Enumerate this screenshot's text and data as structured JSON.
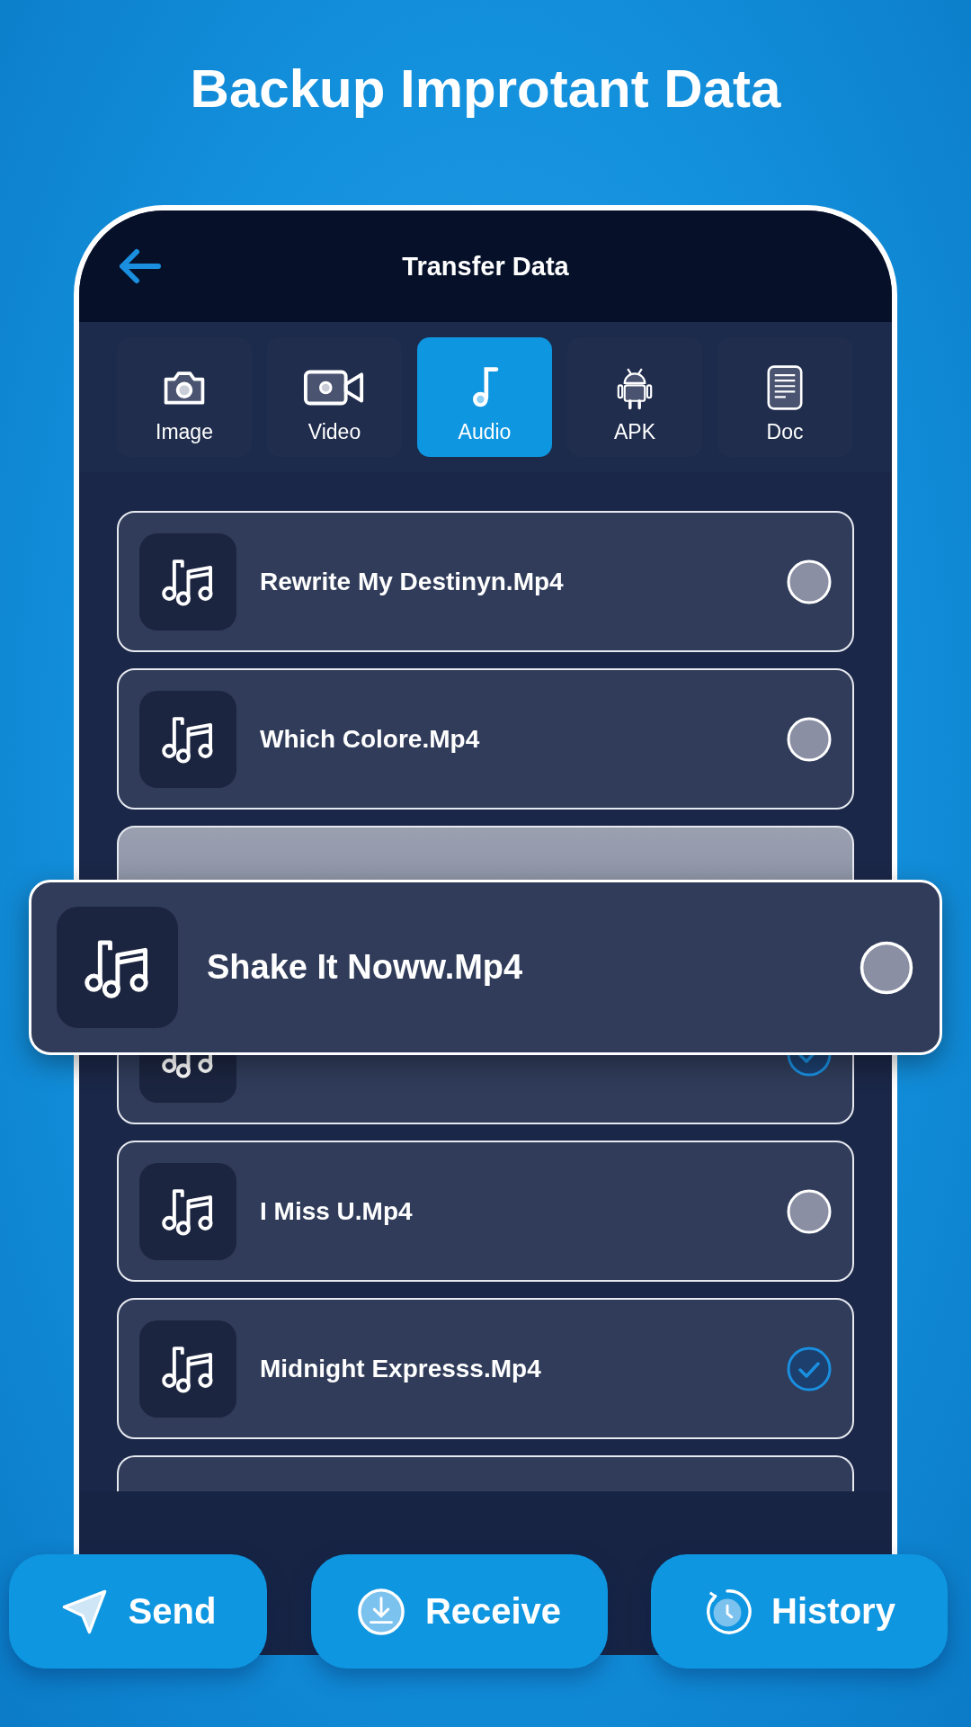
{
  "headline": "Backup Improtant Data",
  "screen": {
    "title": "Transfer Data",
    "tabs": [
      {
        "label": "Image",
        "kind": "camera",
        "selected": false
      },
      {
        "label": "Video",
        "kind": "video",
        "selected": false
      },
      {
        "label": "Audio",
        "kind": "note",
        "selected": true
      },
      {
        "label": "APK",
        "kind": "android",
        "selected": false
      },
      {
        "label": "Doc",
        "kind": "doc",
        "selected": false
      }
    ],
    "rows": [
      {
        "kind": "full",
        "name": "Rewrite My Destinyn.Mp4",
        "selected": false
      },
      {
        "kind": "full",
        "name": "Which Colore.Mp4",
        "selected": false
      },
      {
        "kind": "covered"
      },
      {
        "kind": "full",
        "selected": true
      },
      {
        "kind": "full",
        "name": "I Miss U.Mp4",
        "selected": false
      },
      {
        "kind": "full",
        "name": "Midnight Expresss.Mp4",
        "selected": true
      },
      {
        "kind": "partial"
      }
    ],
    "popped_row": {
      "name": "Shake It Noww.Mp4",
      "selected": false
    }
  },
  "actions": [
    {
      "label": "Send",
      "kind": "send"
    },
    {
      "label": "Receive",
      "kind": "receive"
    },
    {
      "label": "History",
      "kind": "history"
    }
  ]
}
